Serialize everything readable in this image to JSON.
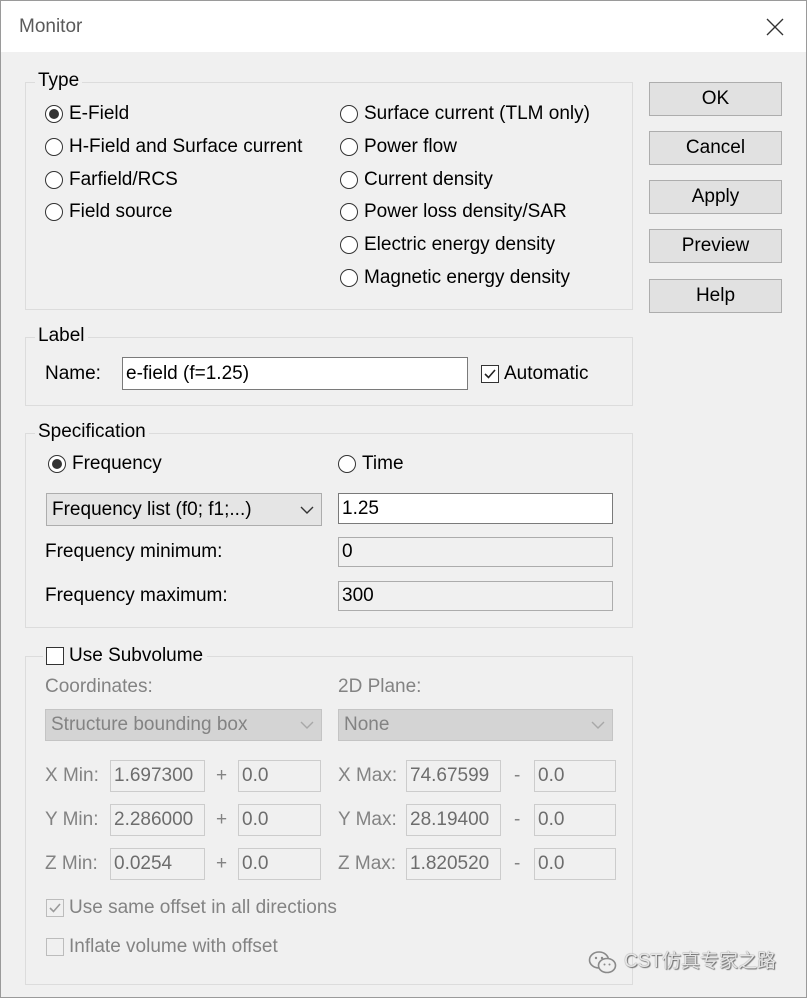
{
  "window": {
    "title": "Monitor",
    "close_icon": "close-icon"
  },
  "type_group": {
    "legend": "Type",
    "options": [
      {
        "label": "E-Field",
        "checked": true
      },
      {
        "label": "H-Field and Surface current",
        "checked": false
      },
      {
        "label": "Farfield/RCS",
        "checked": false
      },
      {
        "label": "Field source",
        "checked": false
      },
      {
        "label": "Surface current (TLM only)",
        "checked": false
      },
      {
        "label": "Power flow",
        "checked": false
      },
      {
        "label": "Current density",
        "checked": false
      },
      {
        "label": "Power loss density/SAR",
        "checked": false
      },
      {
        "label": "Electric energy density",
        "checked": false
      },
      {
        "label": "Magnetic energy density",
        "checked": false
      }
    ]
  },
  "buttons": {
    "ok": "OK",
    "cancel": "Cancel",
    "apply": "Apply",
    "preview": "Preview",
    "help": "Help"
  },
  "label_group": {
    "legend": "Label",
    "name_label": "Name:",
    "name_value": "e-field (f=1.25)",
    "automatic": {
      "label": "Automatic",
      "checked": true
    }
  },
  "specification": {
    "legend": "Specification",
    "frequency": {
      "label": "Frequency",
      "checked": true
    },
    "time": {
      "label": "Time",
      "checked": false
    },
    "sample_type": {
      "selected": "Frequency list (f0; f1;...)",
      "icon": "chevron-down-icon"
    },
    "frequency_list_value": "1.25",
    "frequency_minimum": {
      "label": "Frequency minimum:",
      "value": "0"
    },
    "frequency_maximum": {
      "label": "Frequency maximum:",
      "value": "300"
    }
  },
  "subvolume": {
    "use_subvolume": {
      "label": "Use Subvolume",
      "checked": false
    },
    "coordinates_label": "Coordinates:",
    "coordinates_selected": "Structure bounding box",
    "plane_label": "2D Plane:",
    "plane_selected": "None",
    "rows": [
      {
        "min_label": "X Min:",
        "min_value": "1.697300",
        "plus": "+",
        "min_offset": "0.0",
        "max_label": "X Max:",
        "max_value": "74.67599",
        "minus": "-",
        "max_offset": "0.0"
      },
      {
        "min_label": "Y Min:",
        "min_value": "2.286000",
        "plus": "+",
        "min_offset": "0.0",
        "max_label": "Y Max:",
        "max_value": "28.19400",
        "minus": "-",
        "max_offset": "0.0"
      },
      {
        "min_label": "Z Min:",
        "min_value": "0.0254",
        "plus": "+",
        "min_offset": "0.0",
        "max_label": "Z Max:",
        "max_value": "1.820520",
        "minus": "-",
        "max_offset": "0.0"
      }
    ],
    "same_offset": {
      "label": "Use same offset in all directions",
      "checked": true
    },
    "inflate": {
      "label": "Inflate volume with offset",
      "checked": false
    }
  },
  "watermark": {
    "text": "CST仿真专家之路",
    "icon": "wechat-icon"
  },
  "colors": {
    "dialog_bg": "#f0f0f0",
    "titlebar_bg": "#ffffff",
    "button_bg": "#e1e1e1",
    "button_border": "#adadad",
    "disabled_text": "#838383"
  }
}
